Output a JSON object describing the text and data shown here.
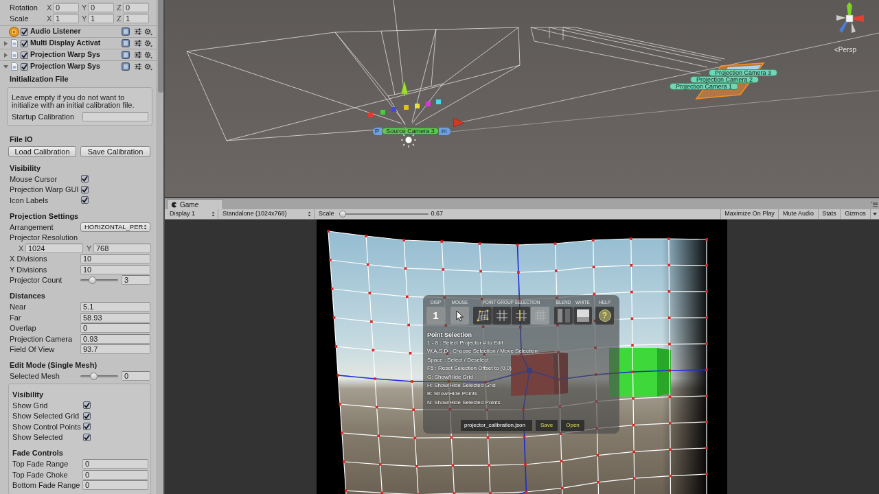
{
  "inspector": {
    "transform_rows": [
      {
        "label": "Rotation",
        "axes": [
          {
            "axis": "X",
            "value": "0"
          },
          {
            "axis": "Y",
            "value": "0"
          },
          {
            "axis": "Z",
            "value": "0"
          }
        ]
      },
      {
        "label": "Scale",
        "axes": [
          {
            "axis": "X",
            "value": "1"
          },
          {
            "axis": "Y",
            "value": "1"
          },
          {
            "axis": "Z",
            "value": "1"
          }
        ]
      }
    ],
    "components": [
      {
        "kind": "audio",
        "name": "Audio Listener",
        "enabled": true
      },
      {
        "kind": "script",
        "name": "Multi Display Activat",
        "enabled": true,
        "expanded": false
      },
      {
        "kind": "script",
        "name": "Projection Warp Sys",
        "enabled": true,
        "expanded": false
      },
      {
        "kind": "script",
        "name": "Projection Warp Sys",
        "enabled": true,
        "expanded": true
      }
    ],
    "rows": [
      {
        "kind": "heading",
        "text": "Initialization File"
      },
      {
        "kind": "helpbox",
        "text": "Leave empty if you do not want to initialize with an initial calibration file.",
        "field": {
          "label": "Startup Calibration"
        }
      },
      {
        "kind": "heading",
        "text": "File IO"
      },
      {
        "kind": "buttons",
        "buttons": [
          "Load Calibration",
          "Save Calibration"
        ]
      },
      {
        "kind": "heading",
        "text": "Visibility"
      },
      {
        "kind": "toggle",
        "label": "Mouse Cursor",
        "checked": true
      },
      {
        "kind": "toggle",
        "label": "Projection Warp GUI",
        "checked": true
      },
      {
        "kind": "toggle",
        "label": "Icon Labels",
        "checked": true
      },
      {
        "kind": "heading",
        "text": "Projection Settings"
      },
      {
        "kind": "dropdown",
        "label": "Arrangement",
        "value": "HORIZONTAL_PER"
      },
      {
        "kind": "label",
        "text": "Projector Resolution"
      },
      {
        "kind": "vector2",
        "axes": [
          {
            "axis": "X",
            "value": "1024"
          },
          {
            "axis": "Y",
            "value": "768"
          }
        ]
      },
      {
        "kind": "field",
        "label": "X Divisions",
        "value": "10"
      },
      {
        "kind": "field",
        "label": "Y Divisions",
        "value": "10"
      },
      {
        "kind": "slider",
        "label": "Projector Count",
        "level": 0.28,
        "value": "3"
      },
      {
        "kind": "heading",
        "text": "Distances"
      },
      {
        "kind": "field",
        "label": "Near",
        "value": "5.1"
      },
      {
        "kind": "field",
        "label": "Far",
        "value": "58.93"
      },
      {
        "kind": "field",
        "label": "Overlap",
        "value": "0"
      },
      {
        "kind": "field",
        "label": "Projection Camera",
        "value": "0.93"
      },
      {
        "kind": "field",
        "label": "Field Of View",
        "value": "93.7"
      },
      {
        "kind": "heading",
        "text": "Edit Mode (Single Mesh)"
      },
      {
        "kind": "slider",
        "label": "Selected Mesh",
        "level": 0.32,
        "value": "0"
      },
      {
        "kind": "group",
        "rows": [
          {
            "kind": "heading",
            "text": "Visibility"
          },
          {
            "kind": "toggle",
            "label": "Show Grid",
            "checked": true
          },
          {
            "kind": "toggle",
            "label": "Show Selected Grid",
            "checked": true
          },
          {
            "kind": "toggle",
            "label": "Show Control Points",
            "checked": true
          },
          {
            "kind": "toggle",
            "label": "Show Selected",
            "checked": true
          },
          {
            "kind": "heading",
            "text": "Fade Controls"
          },
          {
            "kind": "field",
            "label": "Top Fade Range",
            "value": "0"
          },
          {
            "kind": "field",
            "label": "Top Fade Choke",
            "value": "0"
          },
          {
            "kind": "field",
            "label": "Bottom Fade Range",
            "value": "0"
          }
        ]
      }
    ]
  },
  "scene_view": {
    "view_label": "<Persp",
    "labels": [
      {
        "kind": "object",
        "parts": [
          "P",
          "m"
        ],
        "color": "#6d9fe6"
      },
      {
        "kind": "camera",
        "parts": [
          "Source Camera 3"
        ],
        "color": "#5cc94e"
      },
      {
        "kind": "camera",
        "parts": [
          "Projection Camera 3"
        ],
        "color": "#70d6b8"
      },
      {
        "kind": "camera",
        "parts": [
          "Projection Camera 2"
        ],
        "color": "#70d6b8"
      },
      {
        "kind": "camera",
        "parts": [
          "Projection Camera 1"
        ],
        "color": "#70d6b8"
      }
    ]
  },
  "tabs": [
    {
      "label": "Game",
      "selected": true
    }
  ],
  "game_toolbar": {
    "display": "Display 1",
    "resolution": "Standalone (1024x768)",
    "scale_label": "Scale",
    "scale": {
      "level": 0,
      "value": "0.67"
    },
    "buttons": [
      "Maximize On Play",
      "Mute Audio",
      "Stats",
      "Gizmos"
    ]
  },
  "game_view": {
    "gui": {
      "groups": [
        {
          "label": "DISP",
          "buttons": [
            {
              "kind": "number",
              "text": "1"
            }
          ]
        },
        {
          "label": "MOUSE",
          "buttons": [
            {
              "kind": "cursor"
            }
          ]
        },
        {
          "label": "POINT GROUP SELECTION",
          "buttons": [
            {
              "kind": "grid_points",
              "disabled": false
            },
            {
              "kind": "grid_cross",
              "disabled": false
            },
            {
              "kind": "column",
              "disabled": false
            },
            {
              "kind": "grid_fine",
              "disabled": true
            }
          ]
        },
        {
          "label": "BLEND",
          "buttons": [
            {
              "kind": "blend"
            }
          ]
        },
        {
          "label": "WHITE",
          "buttons": [
            {
              "kind": "white"
            }
          ]
        },
        {
          "label": "HELP",
          "buttons": [
            {
              "kind": "help",
              "text": "?"
            }
          ]
        }
      ],
      "title": "Point Selection",
      "shortcuts": [
        "1 - 8 : Select Projector # to Edit",
        "W,A,S,D : Choose Selection / Move Selection",
        "Space : Select / Deselect",
        "F5 : Reset Selection Offset to (0,0)",
        "G: Show/Hide Grid",
        "H: Show/Hide Selected Grid",
        "B: Show/Hide Points",
        "N: Show/Hide Selected Points"
      ],
      "file_field": "projector_calibration.json",
      "file_buttons": [
        "Save",
        "Open"
      ]
    }
  }
}
